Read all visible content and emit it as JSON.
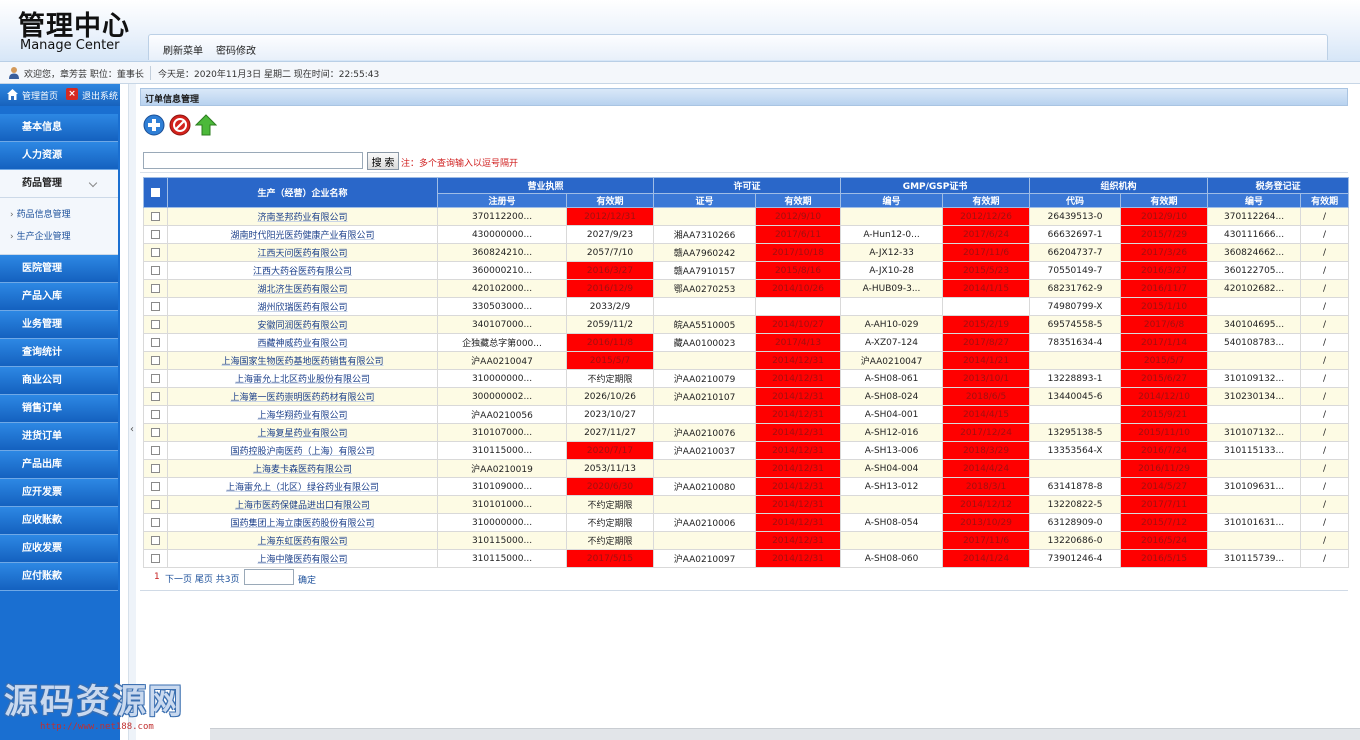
{
  "header": {
    "title_cn": "管理中心",
    "title_en": "Manage Center",
    "tabs": [
      "刷新菜单",
      "密码修改"
    ]
  },
  "infobar": {
    "welcome": "欢迎您，章芳芸  职位：董事长",
    "date": "今天是：2020年11月3日 星期二 现在时间：22:55:43"
  },
  "sidebar": {
    "home_label": "管理首页",
    "exit_label": "退出系统",
    "menu_before": [
      "基本信息",
      "人力资源"
    ],
    "active_menu": "药品管理",
    "submenu": [
      "药品信息管理",
      "生产企业管理"
    ],
    "menu_after": [
      "医院管理",
      "产品入库",
      "业务管理",
      "查询统计",
      "商业公司",
      "销售订单",
      "进货订单",
      "产品出库",
      "应开发票",
      "应收账款",
      "应收发票",
      "应付账款"
    ]
  },
  "content": {
    "title": "订单信息管理",
    "search_button": "搜 索",
    "search_note": "注：多个查询输入以逗号隔开",
    "search_value": "",
    "table": {
      "group_headers": [
        "生产（经营）企业名称",
        "营业执照",
        "许可证",
        "GMP/GSP证书",
        "组织机构",
        "税务登记证"
      ],
      "sub_headers": [
        "注册号",
        "有效期",
        "证号",
        "有效期",
        "编号",
        "有效期",
        "代码",
        "有效期",
        "编号",
        "有效期"
      ],
      "rows": [
        {
          "name": "济南圣邦药业有限公司",
          "c": [
            "370112200...",
            "2012/12/31",
            "",
            "2012/9/10",
            "",
            "2012/12/26",
            "26439513-0",
            "2012/9/10",
            "370112264...",
            "/"
          ],
          "red": [
            1,
            3,
            5,
            7
          ]
        },
        {
          "name": "湖南时代阳光医药健康产业有限公司",
          "c": [
            "430000000...",
            "2027/9/23",
            "湘AA7310266",
            "2017/6/11",
            "A-Hun12-0...",
            "2017/6/24",
            "66632697-1",
            "2015/7/29",
            "430111666...",
            "/"
          ],
          "red": [
            3,
            5,
            7
          ]
        },
        {
          "name": "江西天问医药有限公司",
          "c": [
            "360824210...",
            "2057/7/10",
            "赣AA7960242",
            "2017/10/18",
            "A-JX12-33",
            "2017/11/6",
            "66204737-7",
            "2017/3/26",
            "360824662...",
            "/"
          ],
          "red": [
            3,
            5,
            7
          ]
        },
        {
          "name": "江西大药谷医药有限公司",
          "c": [
            "360000210...",
            "2016/3/27",
            "赣AA7910157",
            "2015/8/16",
            "A-JX10-28",
            "2015/5/23",
            "70550149-7",
            "2016/3/27",
            "360122705...",
            "/"
          ],
          "red": [
            1,
            3,
            5,
            7
          ]
        },
        {
          "name": "湖北济生医药有限公司",
          "c": [
            "420102000...",
            "2016/12/9",
            "鄂AA0270253",
            "2014/10/26",
            "A-HUB09-3...",
            "2014/1/15",
            "68231762-9",
            "2016/11/7",
            "420102682...",
            "/"
          ],
          "red": [
            1,
            3,
            5,
            7
          ]
        },
        {
          "name": "湖州欣瑞医药有限公司",
          "c": [
            "330503000...",
            "2033/2/9",
            "",
            "",
            "",
            "",
            "74980799-X",
            "2015/1/10",
            "",
            "/"
          ],
          "red": [
            7
          ]
        },
        {
          "name": "安徽同润医药有限公司",
          "c": [
            "340107000...",
            "2059/11/2",
            "皖AA5510005",
            "2014/10/27",
            "A-AH10-029",
            "2015/2/19",
            "69574558-5",
            "2017/6/8",
            "340104695...",
            "/"
          ],
          "red": [
            3,
            5,
            7
          ]
        },
        {
          "name": "西藏神威药业有限公司",
          "c": [
            "企独藏总字第000...",
            "2016/11/8",
            "藏AA0100023",
            "2017/4/13",
            "A-XZ07-124",
            "2017/8/27",
            "78351634-4",
            "2017/1/14",
            "540108783...",
            "/"
          ],
          "red": [
            1,
            3,
            5,
            7
          ]
        },
        {
          "name": "上海国家生物医药基地医药销售有限公司",
          "c": [
            "沪AA0210047",
            "2015/5/7",
            "",
            "2014/12/31",
            "沪AA0210047",
            "2014/1/21",
            "",
            "2015/5/7",
            "",
            "/"
          ],
          "red": [
            1,
            3,
            5,
            7
          ]
        },
        {
          "name": "上海雷允上北区药业股份有限公司",
          "c": [
            "310000000...",
            "不约定期限",
            "沪AA0210079",
            "2014/12/31",
            "A-SH08-061",
            "2013/10/1",
            "13228893-1",
            "2015/6/27",
            "310109132...",
            "/"
          ],
          "red": [
            3,
            5,
            7
          ]
        },
        {
          "name": "上海第一医药崇明医药药材有限公司",
          "c": [
            "300000002...",
            "2026/10/26",
            "沪AA0210107",
            "2014/12/31",
            "A-SH08-024",
            "2018/6/5",
            "13440045-6",
            "2014/12/10",
            "310230134...",
            "/"
          ],
          "red": [
            3,
            5,
            7
          ]
        },
        {
          "name": "上海华翔药业有限公司",
          "c": [
            "沪AA0210056",
            "2023/10/27",
            "",
            "2014/12/31",
            "A-SH04-001",
            "2014/4/15",
            "",
            "2015/9/21",
            "",
            "/"
          ],
          "red": [
            3,
            5,
            7
          ]
        },
        {
          "name": "上海复星药业有限公司",
          "c": [
            "310107000...",
            "2027/11/27",
            "沪AA0210076",
            "2014/12/31",
            "A-SH12-016",
            "2017/12/24",
            "13295138-5",
            "2015/11/10",
            "310107132...",
            "/"
          ],
          "red": [
            3,
            5,
            7
          ]
        },
        {
          "name": "国药控股沪南医药（上海）有限公司",
          "c": [
            "310115000...",
            "2020/7/17",
            "沪AA0210037",
            "2014/12/31",
            "A-SH13-006",
            "2018/3/29",
            "13353564-X",
            "2016/7/24",
            "310115133...",
            "/"
          ],
          "red": [
            1,
            3,
            5,
            7
          ]
        },
        {
          "name": "上海麦卡森医药有限公司",
          "c": [
            "沪AA0210019",
            "2053/11/13",
            "",
            "2014/12/31",
            "A-SH04-004",
            "2014/4/24",
            "",
            "2016/11/29",
            "",
            "/"
          ],
          "red": [
            3,
            5,
            7
          ]
        },
        {
          "name": "上海雷允上（北区）绿谷药业有限公司",
          "c": [
            "310109000...",
            "2020/6/30",
            "沪AA0210080",
            "2014/12/31",
            "A-SH13-012",
            "2018/3/1",
            "63141878-8",
            "2014/5/27",
            "310109631...",
            "/"
          ],
          "red": [
            1,
            3,
            5,
            7
          ]
        },
        {
          "name": "上海市医药保健品进出口有限公司",
          "c": [
            "310101000...",
            "不约定期限",
            "",
            "2014/12/31",
            "",
            "2014/12/12",
            "13220822-5",
            "2017/7/11",
            "",
            "/"
          ],
          "red": [
            3,
            5,
            7
          ]
        },
        {
          "name": "国药集团上海立康医药股份有限公司",
          "c": [
            "310000000...",
            "不约定期限",
            "沪AA0210006",
            "2014/12/31",
            "A-SH08-054",
            "2013/10/29",
            "63128909-0",
            "2015/7/12",
            "310101631...",
            "/"
          ],
          "red": [
            3,
            5,
            7
          ]
        },
        {
          "name": "上海东虹医药有限公司",
          "c": [
            "310115000...",
            "不约定期限",
            "",
            "2014/12/31",
            "",
            "2017/11/6",
            "13220686-0",
            "2016/5/24",
            "",
            "/"
          ],
          "red": [
            3,
            5,
            7
          ]
        },
        {
          "name": "上海中隆医药有限公司",
          "c": [
            "310115000...",
            "2017/5/15",
            "沪AA0210097",
            "2014/12/31",
            "A-SH08-060",
            "2014/1/24",
            "73901246-4",
            "2016/5/15",
            "310115739...",
            "/"
          ],
          "red": [
            1,
            3,
            5,
            7
          ]
        }
      ]
    },
    "pager": {
      "current": "1",
      "text": "下一页  尾页  共3页",
      "confirm": "确定"
    }
  },
  "watermark": {
    "text": "源码资源网",
    "url": "http://www.net188.com"
  },
  "colors": {
    "expired": "#ff0000",
    "header_blue": "#2a67c9",
    "sidebar_blue": "#1a6fd1"
  }
}
